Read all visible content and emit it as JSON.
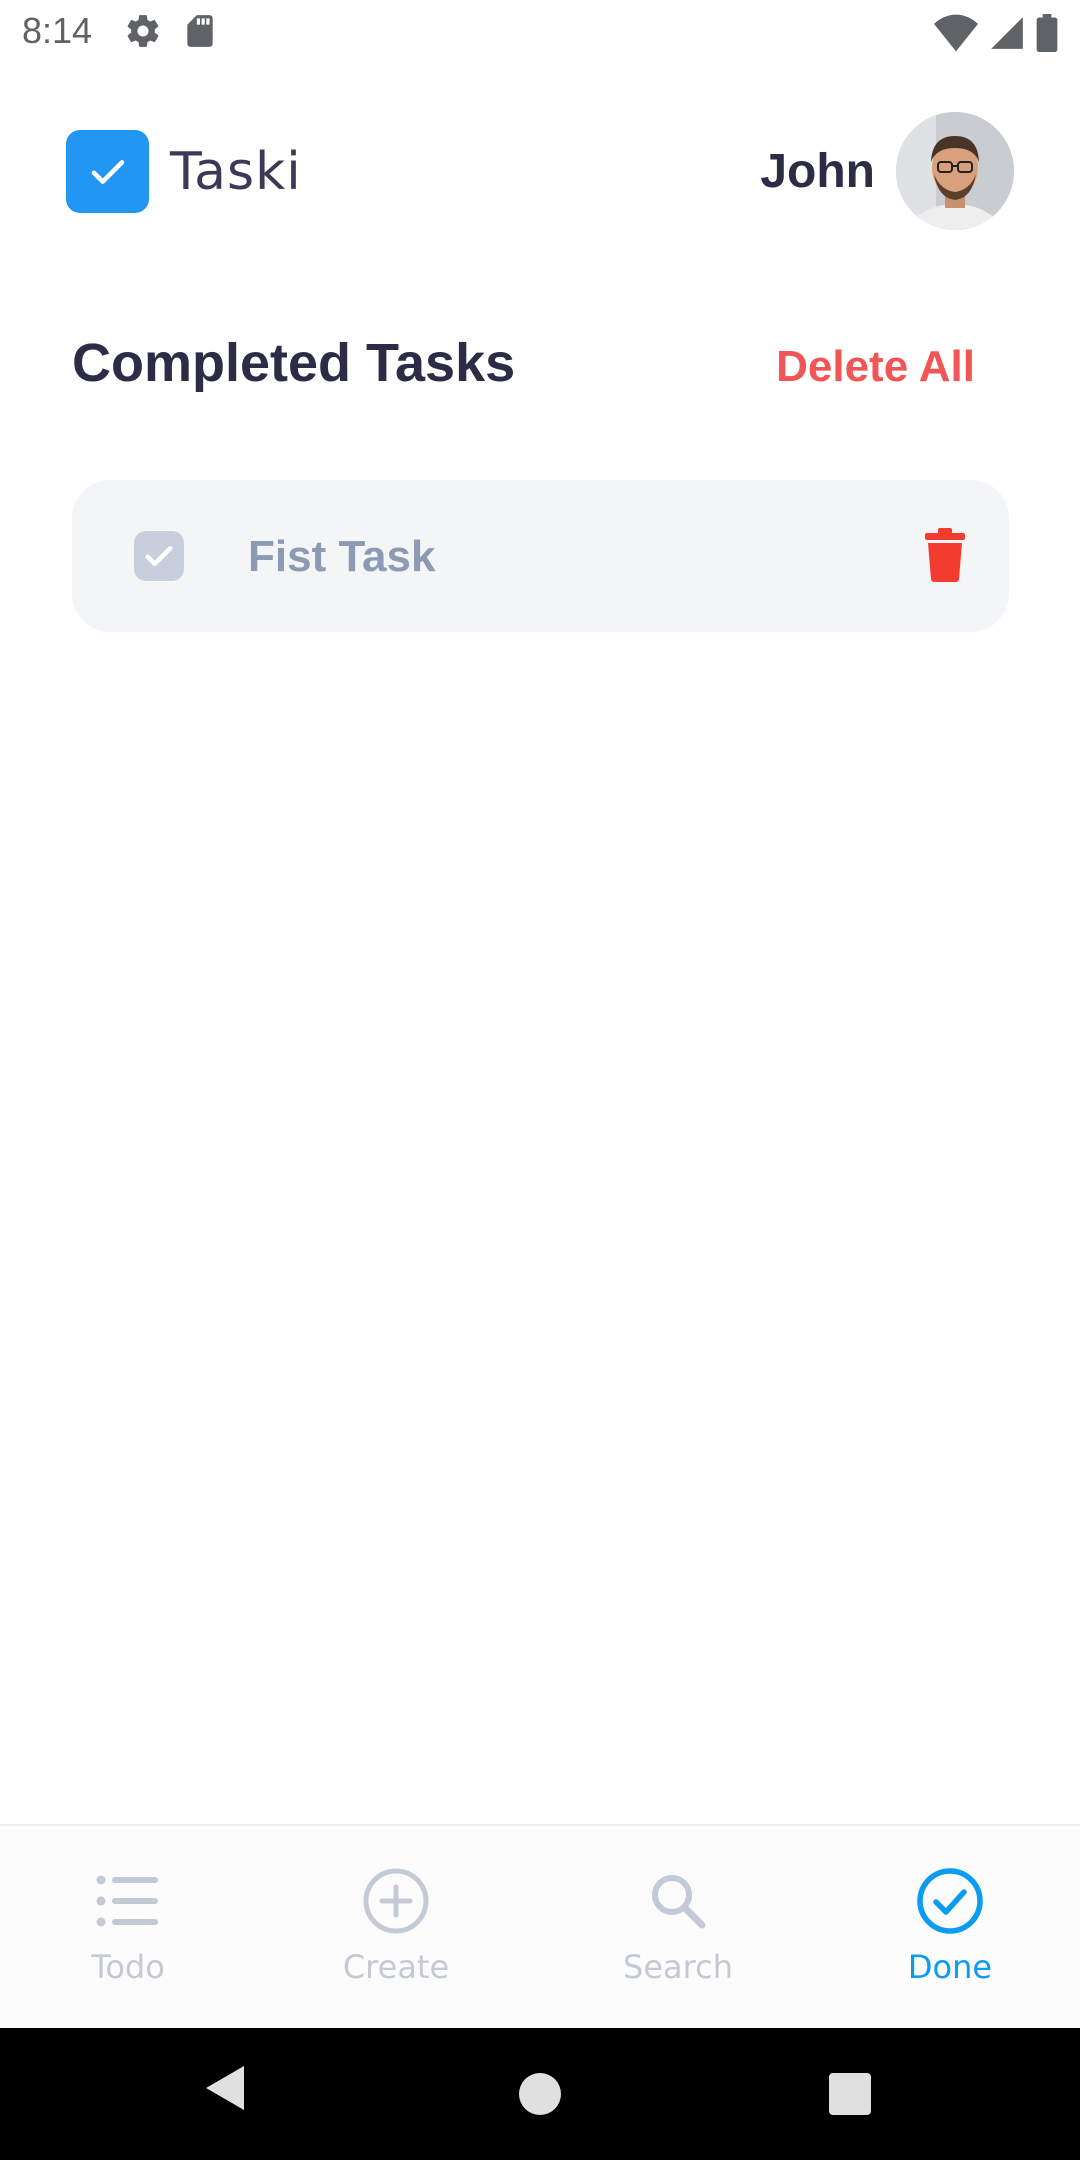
{
  "status_bar": {
    "time": "8:14"
  },
  "header": {
    "app_name": "Taski",
    "user_name": "John"
  },
  "main": {
    "section_title": "Completed Tasks",
    "delete_all_label": "Delete All",
    "tasks": [
      {
        "title": "Fist Task",
        "completed": true
      }
    ]
  },
  "bottom_nav": {
    "items": [
      {
        "label": "Todo",
        "icon": "list-icon",
        "active": false
      },
      {
        "label": "Create",
        "icon": "add-circle-icon",
        "active": false
      },
      {
        "label": "Search",
        "icon": "search-icon",
        "active": false
      },
      {
        "label": "Done",
        "icon": "check-circle-icon",
        "active": true
      }
    ]
  },
  "colors": {
    "accent": "#2196f3",
    "active_nav": "#0a9cf0",
    "inactive_nav": "#c3cad6",
    "danger": "#f25555",
    "trash": "#f33c2f"
  }
}
